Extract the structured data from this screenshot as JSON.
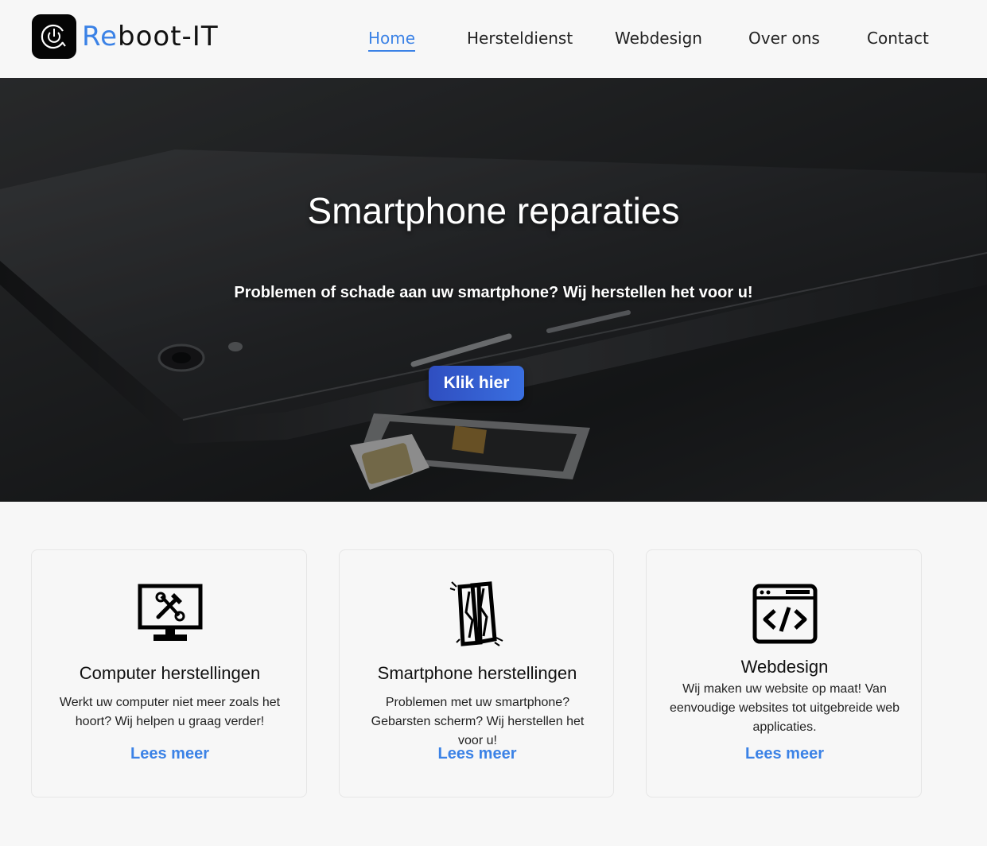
{
  "header": {
    "logo": {
      "text_accent": "Re",
      "text_rest": "boot-IT",
      "icon": "power-refresh-icon",
      "accent_color": "#3b82e6"
    },
    "nav": [
      {
        "label": "Home",
        "active": true
      },
      {
        "label": "Hersteldienst",
        "active": false
      },
      {
        "label": "Webdesign",
        "active": false
      },
      {
        "label": "Over ons",
        "active": false
      },
      {
        "label": "Contact",
        "active": false
      }
    ]
  },
  "hero": {
    "title": "Smartphone reparaties",
    "subtitle": "Problemen of schade aan uw smartphone? Wij herstellen het voor u!",
    "button_label": "Klik hier",
    "button_color": "#3a6fe0"
  },
  "cards": [
    {
      "icon": "monitor-tools-icon",
      "title": "Computer herstellingen",
      "text": "Werkt uw computer niet meer zoals het hoort? Wij helpen u graag verder!",
      "link": "Lees meer"
    },
    {
      "icon": "broken-phone-icon",
      "title": "Smartphone herstellingen",
      "text": "Problemen met uw smartphone? Gebarsten scherm? Wij herstellen het voor u!",
      "link": "Lees meer"
    },
    {
      "icon": "code-window-icon",
      "title": "Webdesign",
      "text": "Wij maken uw website op maat! Van eenvoudige websites tot uitgebreide web applicaties.",
      "link": "Lees meer"
    }
  ]
}
